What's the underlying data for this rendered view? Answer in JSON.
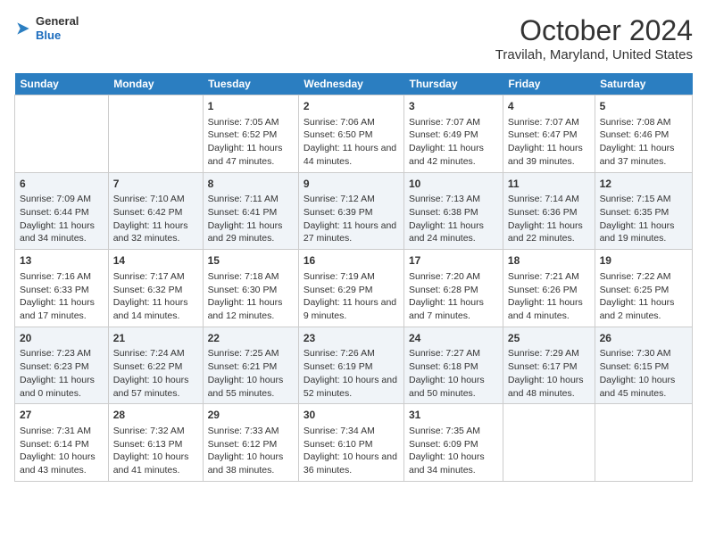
{
  "header": {
    "logo": {
      "general": "General",
      "blue": "Blue"
    },
    "title": "October 2024",
    "subtitle": "Travilah, Maryland, United States"
  },
  "days_of_week": [
    "Sunday",
    "Monday",
    "Tuesday",
    "Wednesday",
    "Thursday",
    "Friday",
    "Saturday"
  ],
  "weeks": [
    [
      {
        "day": "",
        "info": ""
      },
      {
        "day": "",
        "info": ""
      },
      {
        "day": "1",
        "info": "Sunrise: 7:05 AM\nSunset: 6:52 PM\nDaylight: 11 hours and 47 minutes."
      },
      {
        "day": "2",
        "info": "Sunrise: 7:06 AM\nSunset: 6:50 PM\nDaylight: 11 hours and 44 minutes."
      },
      {
        "day": "3",
        "info": "Sunrise: 7:07 AM\nSunset: 6:49 PM\nDaylight: 11 hours and 42 minutes."
      },
      {
        "day": "4",
        "info": "Sunrise: 7:07 AM\nSunset: 6:47 PM\nDaylight: 11 hours and 39 minutes."
      },
      {
        "day": "5",
        "info": "Sunrise: 7:08 AM\nSunset: 6:46 PM\nDaylight: 11 hours and 37 minutes."
      }
    ],
    [
      {
        "day": "6",
        "info": "Sunrise: 7:09 AM\nSunset: 6:44 PM\nDaylight: 11 hours and 34 minutes."
      },
      {
        "day": "7",
        "info": "Sunrise: 7:10 AM\nSunset: 6:42 PM\nDaylight: 11 hours and 32 minutes."
      },
      {
        "day": "8",
        "info": "Sunrise: 7:11 AM\nSunset: 6:41 PM\nDaylight: 11 hours and 29 minutes."
      },
      {
        "day": "9",
        "info": "Sunrise: 7:12 AM\nSunset: 6:39 PM\nDaylight: 11 hours and 27 minutes."
      },
      {
        "day": "10",
        "info": "Sunrise: 7:13 AM\nSunset: 6:38 PM\nDaylight: 11 hours and 24 minutes."
      },
      {
        "day": "11",
        "info": "Sunrise: 7:14 AM\nSunset: 6:36 PM\nDaylight: 11 hours and 22 minutes."
      },
      {
        "day": "12",
        "info": "Sunrise: 7:15 AM\nSunset: 6:35 PM\nDaylight: 11 hours and 19 minutes."
      }
    ],
    [
      {
        "day": "13",
        "info": "Sunrise: 7:16 AM\nSunset: 6:33 PM\nDaylight: 11 hours and 17 minutes."
      },
      {
        "day": "14",
        "info": "Sunrise: 7:17 AM\nSunset: 6:32 PM\nDaylight: 11 hours and 14 minutes."
      },
      {
        "day": "15",
        "info": "Sunrise: 7:18 AM\nSunset: 6:30 PM\nDaylight: 11 hours and 12 minutes."
      },
      {
        "day": "16",
        "info": "Sunrise: 7:19 AM\nSunset: 6:29 PM\nDaylight: 11 hours and 9 minutes."
      },
      {
        "day": "17",
        "info": "Sunrise: 7:20 AM\nSunset: 6:28 PM\nDaylight: 11 hours and 7 minutes."
      },
      {
        "day": "18",
        "info": "Sunrise: 7:21 AM\nSunset: 6:26 PM\nDaylight: 11 hours and 4 minutes."
      },
      {
        "day": "19",
        "info": "Sunrise: 7:22 AM\nSunset: 6:25 PM\nDaylight: 11 hours and 2 minutes."
      }
    ],
    [
      {
        "day": "20",
        "info": "Sunrise: 7:23 AM\nSunset: 6:23 PM\nDaylight: 11 hours and 0 minutes."
      },
      {
        "day": "21",
        "info": "Sunrise: 7:24 AM\nSunset: 6:22 PM\nDaylight: 10 hours and 57 minutes."
      },
      {
        "day": "22",
        "info": "Sunrise: 7:25 AM\nSunset: 6:21 PM\nDaylight: 10 hours and 55 minutes."
      },
      {
        "day": "23",
        "info": "Sunrise: 7:26 AM\nSunset: 6:19 PM\nDaylight: 10 hours and 52 minutes."
      },
      {
        "day": "24",
        "info": "Sunrise: 7:27 AM\nSunset: 6:18 PM\nDaylight: 10 hours and 50 minutes."
      },
      {
        "day": "25",
        "info": "Sunrise: 7:29 AM\nSunset: 6:17 PM\nDaylight: 10 hours and 48 minutes."
      },
      {
        "day": "26",
        "info": "Sunrise: 7:30 AM\nSunset: 6:15 PM\nDaylight: 10 hours and 45 minutes."
      }
    ],
    [
      {
        "day": "27",
        "info": "Sunrise: 7:31 AM\nSunset: 6:14 PM\nDaylight: 10 hours and 43 minutes."
      },
      {
        "day": "28",
        "info": "Sunrise: 7:32 AM\nSunset: 6:13 PM\nDaylight: 10 hours and 41 minutes."
      },
      {
        "day": "29",
        "info": "Sunrise: 7:33 AM\nSunset: 6:12 PM\nDaylight: 10 hours and 38 minutes."
      },
      {
        "day": "30",
        "info": "Sunrise: 7:34 AM\nSunset: 6:10 PM\nDaylight: 10 hours and 36 minutes."
      },
      {
        "day": "31",
        "info": "Sunrise: 7:35 AM\nSunset: 6:09 PM\nDaylight: 10 hours and 34 minutes."
      },
      {
        "day": "",
        "info": ""
      },
      {
        "day": "",
        "info": ""
      }
    ]
  ]
}
